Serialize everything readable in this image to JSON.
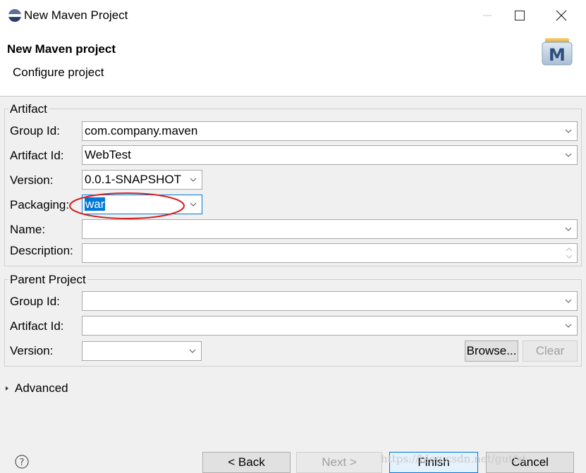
{
  "window": {
    "title": "New Maven Project",
    "icon": "eclipse-icon",
    "controls": [
      "minimize-icon",
      "maximize-icon",
      "close-icon"
    ]
  },
  "header": {
    "title": "New Maven project",
    "subtitle": "Configure project",
    "logo_letter": "M"
  },
  "artifact": {
    "legend": "Artifact",
    "group_id": {
      "label": "Group Id:",
      "value": "com.company.maven"
    },
    "artifact_id": {
      "label": "Artifact Id:",
      "value": "WebTest"
    },
    "version": {
      "label": "Version:",
      "value": "0.0.1-SNAPSHOT"
    },
    "packaging": {
      "label": "Packaging:",
      "value": "war"
    },
    "name": {
      "label": "Name:",
      "value": ""
    },
    "description": {
      "label": "Description:",
      "value": ""
    }
  },
  "parent": {
    "legend": "Parent Project",
    "group_id": {
      "label": "Group Id:",
      "value": ""
    },
    "artifact_id": {
      "label": "Artifact Id:",
      "value": ""
    },
    "version": {
      "label": "Version:",
      "value": ""
    },
    "browse_label": "Browse...",
    "clear_label": "Clear"
  },
  "advanced": {
    "label": "Advanced"
  },
  "footer": {
    "help_icon": "help-icon",
    "back_label": "< Back",
    "next_label": "Next >",
    "finish_label": "Finish",
    "cancel_label": "Cancel"
  },
  "annotation": {
    "color": "#d42020",
    "target": "packaging"
  },
  "colors": {
    "selection": "#0078d7",
    "primary_border": "#0078d7"
  },
  "watermark": "https://blog.csdn.net/gutfst"
}
